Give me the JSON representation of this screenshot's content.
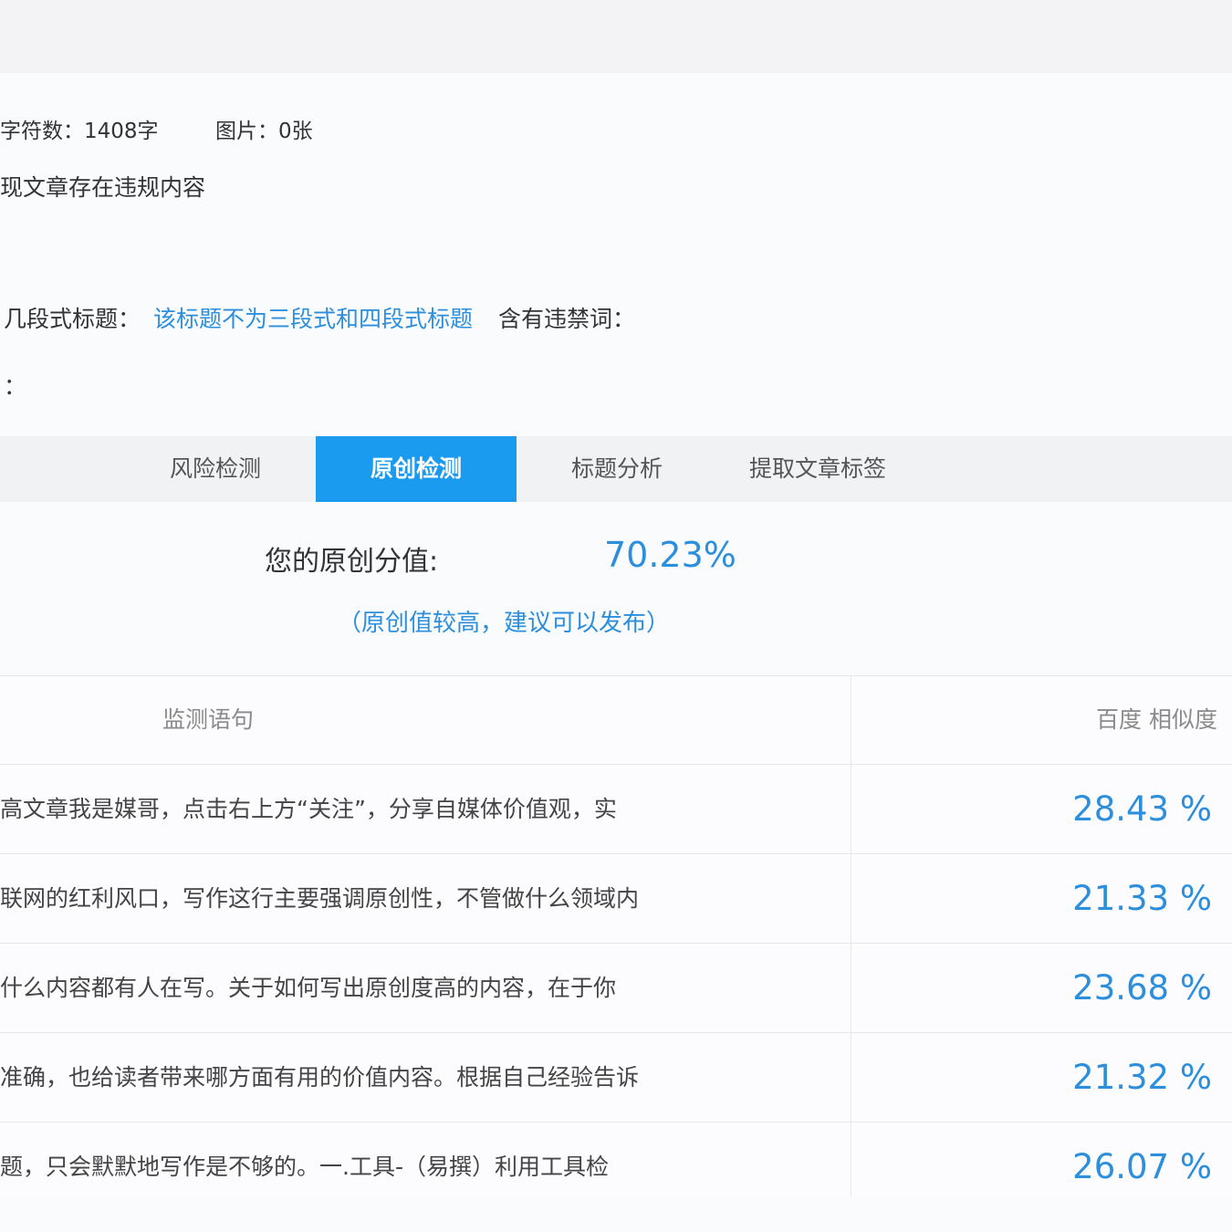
{
  "stats": {
    "chars": "字符数：1408字",
    "images": "图片：0张"
  },
  "warning": "现文章存在违规内容",
  "title_check": {
    "label": "几段式标题：",
    "value": "该标题不为三段式和四段式标题",
    "banned_label": "含有违禁词："
  },
  "colon_line": "：",
  "tabs": [
    {
      "label": "风险检测"
    },
    {
      "label": "原创检测",
      "active": true
    },
    {
      "label": "标题分析"
    },
    {
      "label": "提取文章标签"
    }
  ],
  "score": {
    "label": "您的原创分值:",
    "value": "70.23%",
    "note": "（原创值较高，建议可以发布）"
  },
  "table": {
    "headers": [
      "监测语句",
      "百度 相似度"
    ],
    "rows": [
      {
        "sentence": "高文章我是媒哥，点击右上方“关注”，分享自媒体价值观，实",
        "similarity": "28.43 %"
      },
      {
        "sentence": "联网的红利风口，写作这行主要强调原创性，不管做什么领域内",
        "similarity": "21.33 %"
      },
      {
        "sentence": "什么内容都有人在写。关于如何写出原创度高的内容，在于你",
        "similarity": "23.68 %"
      },
      {
        "sentence": "准确，也给读者带来哪方面有用的价值内容。根据自己经验告诉",
        "similarity": "21.32 %"
      },
      {
        "sentence": "题，只会默默地写作是不够的。一.工具-（易撰）利用工具检",
        "similarity": "26.07 %"
      }
    ]
  },
  "colors": {
    "accent": "#1a9bf0",
    "link": "#2d8fdc"
  }
}
